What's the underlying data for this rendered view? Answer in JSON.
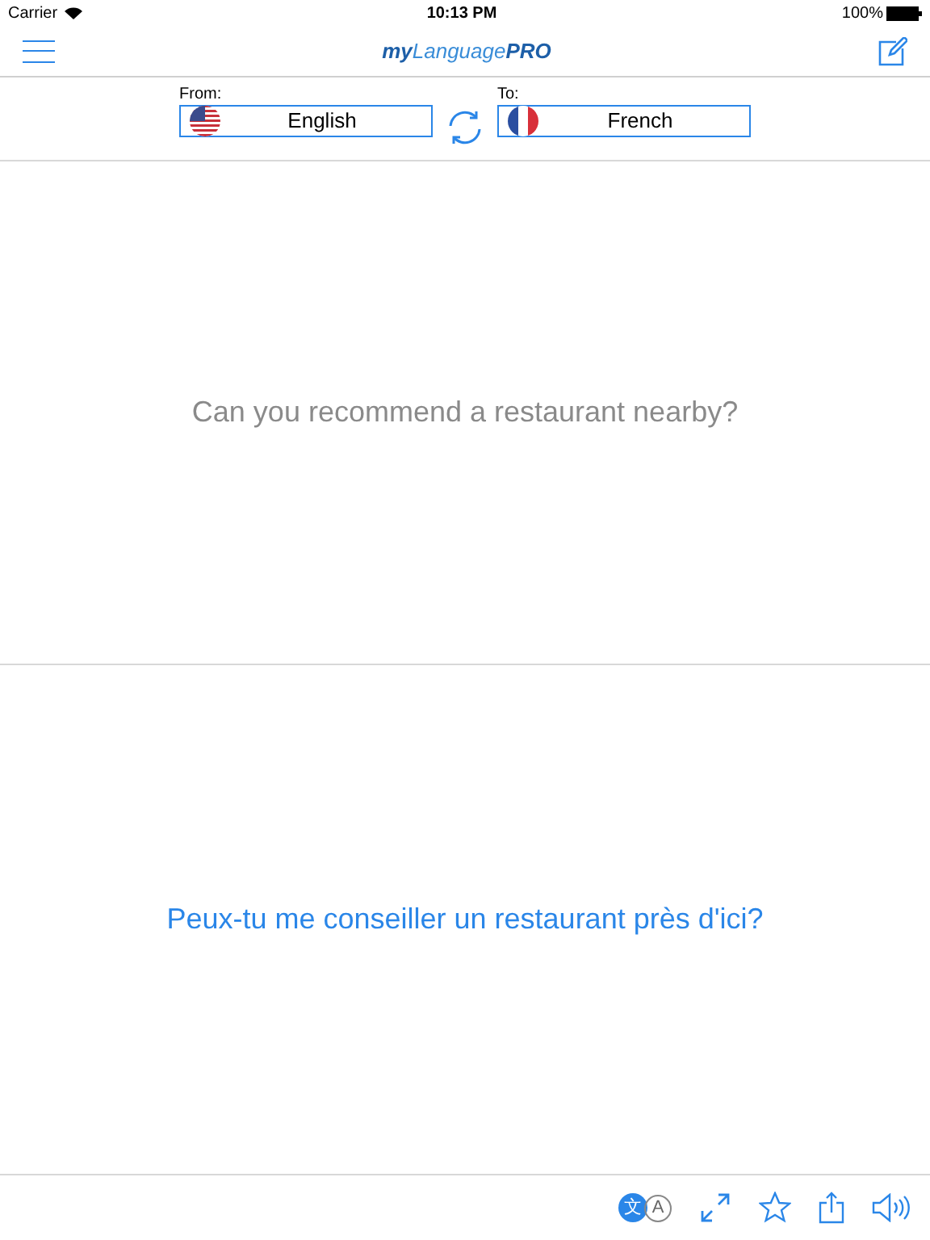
{
  "status_bar": {
    "carrier": "Carrier",
    "time": "10:13 PM",
    "battery": "100%"
  },
  "nav": {
    "logo": {
      "prefix": "my",
      "name": "Language",
      "suffix": "PRO"
    }
  },
  "languages": {
    "from": {
      "label": "From:",
      "value": "English",
      "flag": {
        "kind": "us"
      }
    },
    "to": {
      "label": "To:",
      "value": "French",
      "flag": {
        "kind": "fr"
      }
    }
  },
  "source_text": "Can you recommend a restaurant nearby?",
  "translation_text": "Peux-tu me conseiller un restaurant près d'ici?",
  "toolbar": {
    "translate_toggle": {
      "source_glyph": "文",
      "target_glyph": "A"
    }
  }
}
